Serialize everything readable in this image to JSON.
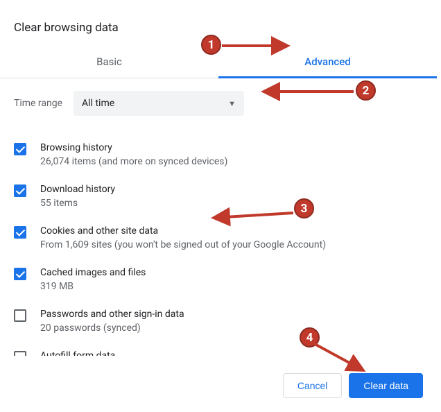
{
  "dialog": {
    "title": "Clear browsing data"
  },
  "tabs": {
    "basic": "Basic",
    "advanced": "Advanced"
  },
  "time_range": {
    "label": "Time range",
    "value": "All time"
  },
  "options": [
    {
      "checked": true,
      "label": "Browsing history",
      "sub": "26,074 items (and more on synced devices)"
    },
    {
      "checked": true,
      "label": "Download history",
      "sub": "55 items"
    },
    {
      "checked": true,
      "label": "Cookies and other site data",
      "sub": "From 1,609 sites (you won't be signed out of your Google Account)"
    },
    {
      "checked": true,
      "label": "Cached images and files",
      "sub": "319 MB"
    },
    {
      "checked": false,
      "label": "Passwords and other sign-in data",
      "sub": "20 passwords (synced)"
    },
    {
      "checked": false,
      "label": "Autofill form data",
      "sub": ""
    }
  ],
  "footer": {
    "cancel": "Cancel",
    "clear": "Clear data"
  },
  "annotations": {
    "1": "1",
    "2": "2",
    "3": "3",
    "4": "4"
  }
}
